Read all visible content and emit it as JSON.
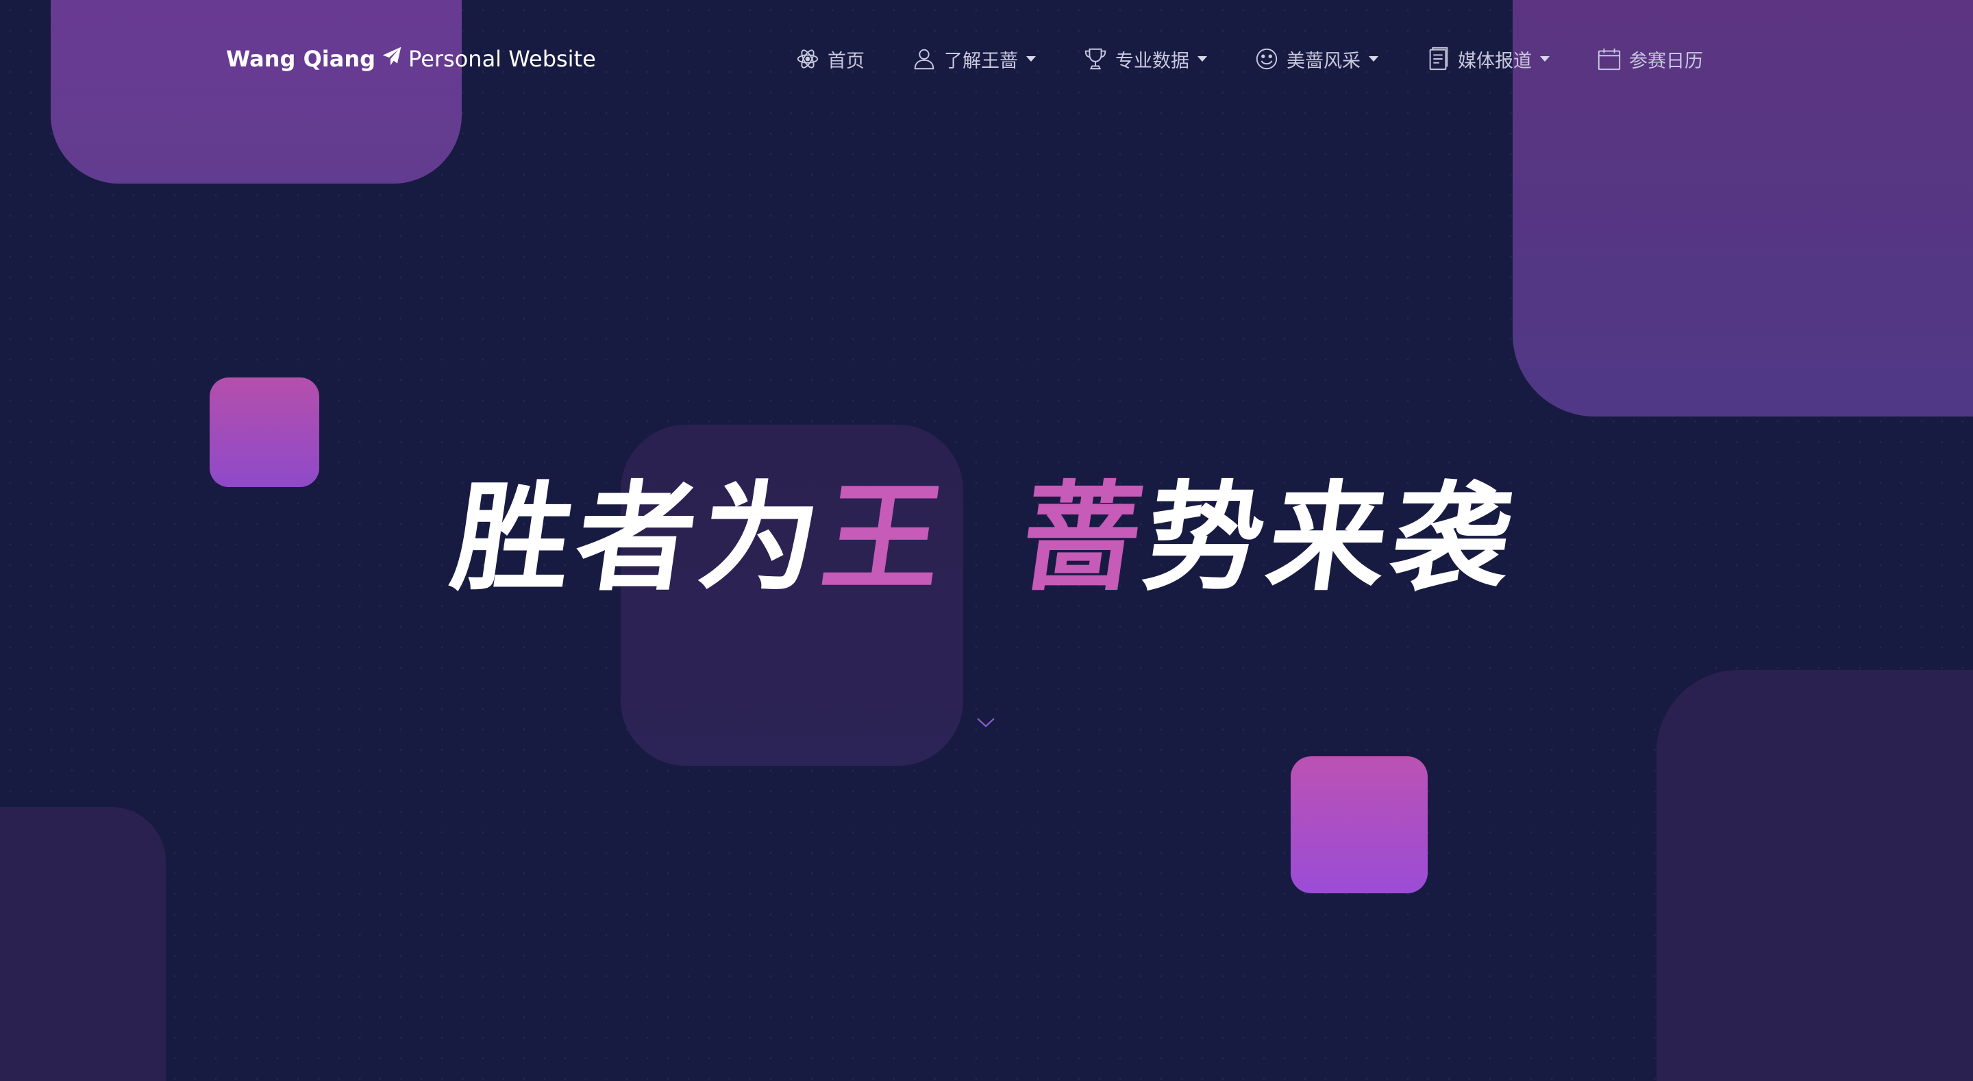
{
  "header": {
    "brand_name": "Wang Qiang",
    "brand_tagline": "Personal Website",
    "brand_icon": "paper-plane-icon"
  },
  "nav": {
    "items": [
      {
        "label": "首页",
        "icon": "atom-icon",
        "has_dropdown": false
      },
      {
        "label": "了解王蔷",
        "icon": "user-icon",
        "has_dropdown": true
      },
      {
        "label": "专业数据",
        "icon": "trophy-icon",
        "has_dropdown": true
      },
      {
        "label": "美蔷风采",
        "icon": "smile-icon",
        "has_dropdown": true
      },
      {
        "label": "媒体报道",
        "icon": "document-icon",
        "has_dropdown": true
      },
      {
        "label": "参赛日历",
        "icon": "calendar-icon",
        "has_dropdown": false
      }
    ]
  },
  "hero": {
    "part1_white": "胜者为",
    "part1_pink": "王",
    "part2_pink": "蔷",
    "part2_white": "势来袭"
  },
  "colors": {
    "background": "#181b41",
    "accent_pink": "#c65bb8",
    "accent_purple": "#9b4cd6",
    "nav_text": "#c9c9df"
  },
  "scroll_indicator_icon": "chevron-down-icon"
}
